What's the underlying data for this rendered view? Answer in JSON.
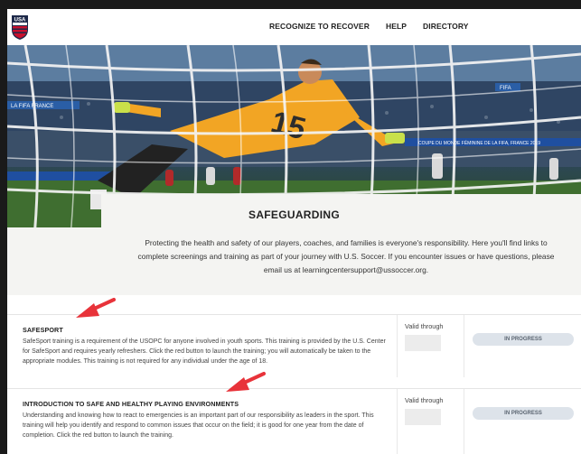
{
  "nav": {
    "logo_text": "USA",
    "links": [
      "RECOGNIZE TO RECOVER",
      "HELP",
      "DIRECTORY"
    ]
  },
  "hero": {
    "jersey_number": "15",
    "banners": [
      "FIFA",
      "LA FIFA FRANCE",
      "COUPE DU MONDE FÉMININE DE LA FIFA, FRANCE 2019"
    ]
  },
  "safeguarding": {
    "title": "SAFEGUARDING",
    "intro": "Protecting the health and safety of our players, coaches, and families is everyone's responsibility. Here you'll find links to complete screenings and training as part of your journey with U.S. Soccer. If you encounter issues or have questions, please email us at learningcentersupport@ussoccer.org."
  },
  "trainings": [
    {
      "title": "SAFESPORT",
      "description": "SafeSport training is a requirement of the USOPC for anyone involved in youth sports. This training is provided by the U.S. Center for SafeSport and requires yearly refreshers. Click the red button to launch the training; you will automatically be taken to the appropriate modules. This training is not required for any individual under the age of 18.",
      "valid_label": "Valid through",
      "status": "IN PROGRESS"
    },
    {
      "title": "INTRODUCTION TO SAFE AND HEALTHY PLAYING ENVIRONMENTS",
      "description": "Understanding and knowing how to react to emergencies is an important part of our responsibility as leaders in the sport. This training will help you identify and respond to common issues that occur on the field; it is good for one year from the date of completion. Click the red button to launch the training.",
      "valid_label": "Valid through",
      "status": "IN PROGRESS"
    }
  ],
  "colors": {
    "arrow": "#e8333a",
    "status_pill": "#dde3ea",
    "intro_bg": "#f4f4f2"
  }
}
